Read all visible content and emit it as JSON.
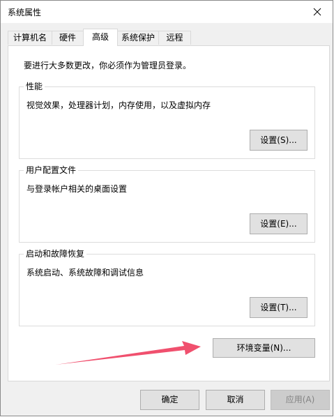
{
  "window": {
    "title": "系统属性"
  },
  "tabs": [
    {
      "label": "计算机名"
    },
    {
      "label": "硬件"
    },
    {
      "label": "高级",
      "active": true
    },
    {
      "label": "系统保护"
    },
    {
      "label": "远程"
    }
  ],
  "main": {
    "admin_note": "要进行大多数更改，你必须作为管理员登录。",
    "performance": {
      "title": "性能",
      "description": "视觉效果，处理器计划，内存使用，以及虚拟内存",
      "button_label": "设置(S)..."
    },
    "user_profiles": {
      "title": "用户配置文件",
      "description": "与登录帐户相关的桌面设置",
      "button_label": "设置(E)..."
    },
    "startup_recovery": {
      "title": "启动和故障恢复",
      "description": "系统启动、系统故障和调试信息",
      "button_label": "设置(T)..."
    },
    "env_vars_button": "环境变量(N)..."
  },
  "footer": {
    "ok_label": "确定",
    "cancel_label": "取消",
    "apply_label": "应用(A)",
    "apply_enabled": false
  },
  "icons": {
    "close": "close-icon"
  },
  "colors": {
    "annotation_arrow": "#f0506e",
    "window_bg": "#f0f0f0",
    "panel_bg": "#ffffff",
    "button_bg": "#e1e1e1"
  }
}
